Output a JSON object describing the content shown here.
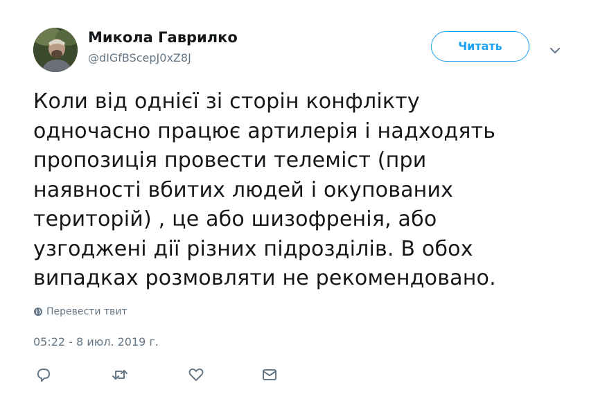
{
  "tweet": {
    "author": {
      "display_name": "Микола Гаврилко",
      "handle": "@dIGfBScepJ0xZ8J"
    },
    "follow_button_label": "Читать",
    "text_lines": [
      "Коли від однієї зі сторін конфлікту",
      "одночасно працює артилерія і надходять",
      "пропозиція провести телеміст (при",
      "наявності вбитих людей і окупованих",
      "територій) , це або шизофренія, або",
      "узгоджені дії різних підрозділів. В обох",
      "випадках розмовляти не рекомендовано."
    ],
    "translate_label": "Перевести твит",
    "timestamp": "05:22 - 8 июл. 2019 г.",
    "actions": [
      "reply-icon",
      "retweet-icon",
      "like-icon",
      "direct-message-icon"
    ]
  },
  "colors": {
    "accent": "#1da1f2",
    "text": "#14171a",
    "secondary_text": "#657786"
  }
}
